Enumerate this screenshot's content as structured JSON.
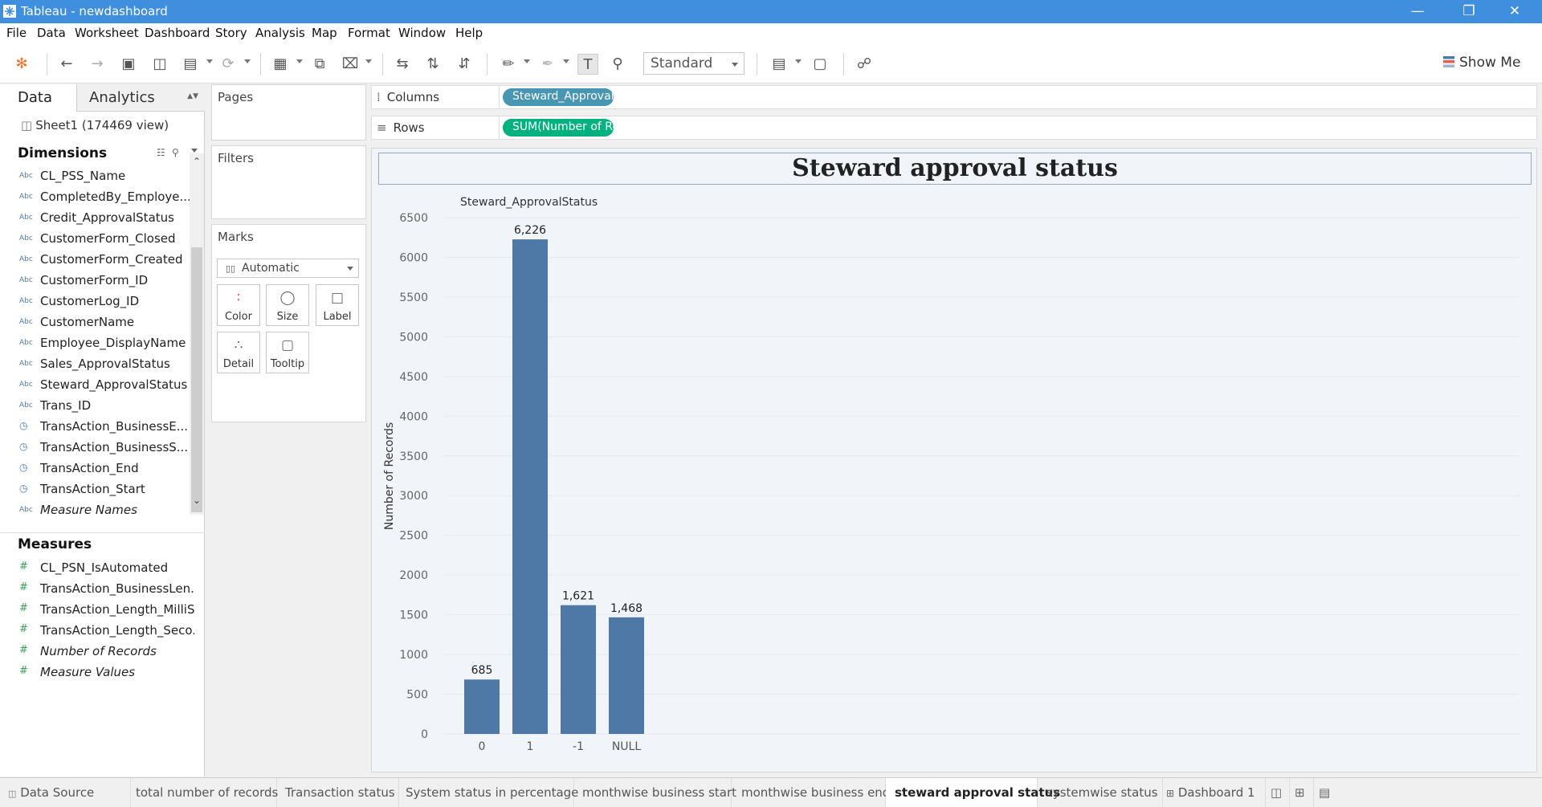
{
  "window": {
    "title": "Tableau - newdashboard"
  },
  "menu": [
    "File",
    "Data",
    "Worksheet",
    "Dashboard",
    "Story",
    "Analysis",
    "Map",
    "Format",
    "Window",
    "Help"
  ],
  "toolbar": {
    "fit_mode": "Standard",
    "show_me": "Show Me"
  },
  "left": {
    "tab_data": "Data",
    "tab_analytics": "Analytics",
    "datasource": "Sheet1 (174469 view)",
    "dimensions_title": "Dimensions",
    "dimensions": [
      {
        "icon": "Abc",
        "label": "CL_PSS_Name"
      },
      {
        "icon": "Abc",
        "label": "CompletedBy_Employe..."
      },
      {
        "icon": "Abc",
        "label": "Credit_ApprovalStatus"
      },
      {
        "icon": "Abc",
        "label": "CustomerForm_Closed"
      },
      {
        "icon": "Abc",
        "label": "CustomerForm_Created"
      },
      {
        "icon": "Abc",
        "label": "CustomerForm_ID"
      },
      {
        "icon": "Abc",
        "label": "CustomerLog_ID"
      },
      {
        "icon": "Abc",
        "label": "CustomerName"
      },
      {
        "icon": "Abc",
        "label": "Employee_DisplayName"
      },
      {
        "icon": "Abc",
        "label": "Sales_ApprovalStatus"
      },
      {
        "icon": "Abc",
        "label": "Steward_ApprovalStatus"
      },
      {
        "icon": "Abc",
        "label": "Trans_ID"
      },
      {
        "icon": "datetime",
        "label": "TransAction_BusinessE..."
      },
      {
        "icon": "datetime",
        "label": "TransAction_BusinessS..."
      },
      {
        "icon": "datetime",
        "label": "TransAction_End"
      },
      {
        "icon": "datetime",
        "label": "TransAction_Start"
      },
      {
        "icon": "Abc",
        "label": "Measure Names"
      }
    ],
    "measures_title": "Measures",
    "measures": [
      {
        "icon": "#",
        "label": "CL_PSN_IsAutomated"
      },
      {
        "icon": "#",
        "label": "TransAction_BusinessLen..."
      },
      {
        "icon": "#",
        "label": "TransAction_Length_MilliS..."
      },
      {
        "icon": "#",
        "label": "TransAction_Length_Seco..."
      },
      {
        "icon": "#",
        "label": "Number of Records"
      },
      {
        "icon": "#",
        "label": "Measure Values"
      }
    ]
  },
  "cards": {
    "pages": "Pages",
    "filters": "Filters",
    "marks": "Marks",
    "mark_type": "Automatic",
    "mark_buttons": [
      "Color",
      "Size",
      "Label",
      "Detail",
      "Tooltip"
    ]
  },
  "shelves": {
    "columns_label": "Columns",
    "columns_pill": "Steward_ApprovalS..",
    "rows_label": "Rows",
    "rows_pill": "SUM(Number of Re.."
  },
  "colors": {
    "bar": "#4e79a7",
    "pill_dimension": "#4996b2",
    "pill_measure": "#00b180",
    "title_bar": "#3f8fde"
  },
  "chart_data": {
    "type": "bar",
    "title": "Steward approval status",
    "header": "Steward_ApprovalStatus",
    "ylabel": "Number of Records",
    "categories": [
      "0",
      "1",
      "-1",
      "NULL"
    ],
    "values": [
      685,
      6226,
      1621,
      1468
    ],
    "data_labels": [
      "685",
      "6,226",
      "1,621",
      "1,468"
    ],
    "ylim": [
      0,
      6500
    ],
    "yticks": [
      0,
      500,
      1000,
      1500,
      2000,
      2500,
      3000,
      3500,
      4000,
      4500,
      5000,
      5500,
      6000,
      6500
    ]
  },
  "sheet_tabs": [
    {
      "label": "Data Source",
      "active": false
    },
    {
      "label": "total number of records",
      "active": false
    },
    {
      "label": "Transaction status",
      "active": false
    },
    {
      "label": "System status in percentage",
      "active": false
    },
    {
      "label": "monthwise business start",
      "active": false
    },
    {
      "label": "monthwise business end",
      "active": false
    },
    {
      "label": "steward approval status",
      "active": true
    },
    {
      "label": "systemwise status",
      "active": false
    },
    {
      "label": "Dashboard 1",
      "active": false
    }
  ]
}
